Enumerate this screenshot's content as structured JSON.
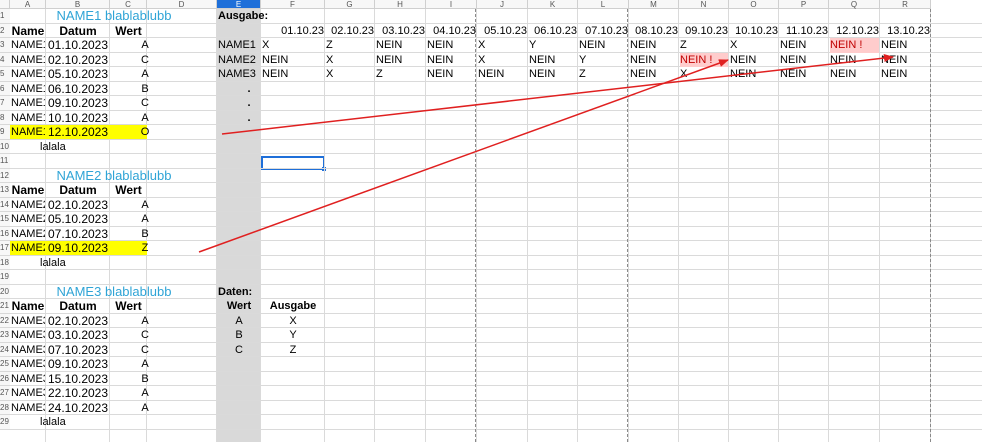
{
  "columns": [
    "A",
    "B",
    "C",
    "D",
    "E",
    "F",
    "G",
    "H",
    "I",
    "J",
    "K",
    "L",
    "M",
    "N",
    "O",
    "P",
    "Q",
    "R"
  ],
  "selected_column": "E",
  "rows": [
    "1",
    "2",
    "3",
    "4",
    "5",
    "6",
    "7",
    "8",
    "9",
    "10",
    "11",
    "12",
    "13",
    "14",
    "15",
    "16",
    "17",
    "18",
    "19",
    "20",
    "21",
    "22",
    "23",
    "24",
    "25",
    "26",
    "27",
    "28",
    "29"
  ],
  "sections": [
    {
      "title": "NAME1 blablablubb",
      "headers": [
        "Name",
        "Datum",
        "Wert"
      ],
      "rows": [
        [
          "NAME1",
          "01.10.2023",
          "A"
        ],
        [
          "NAME1",
          "02.10.2023",
          "C"
        ],
        [
          "NAME1",
          "05.10.2023",
          "A"
        ],
        [
          "NAME1",
          "06.10.2023",
          "B"
        ],
        [
          "NAME1",
          "09.10.2023",
          "C"
        ],
        [
          "NAME1",
          "10.10.2023",
          "A"
        ],
        [
          "NAME1",
          "12.10.2023",
          "O"
        ]
      ],
      "footer": "lalala"
    },
    {
      "title": "NAME2 blablablubb",
      "headers": [
        "Name",
        "Datum",
        "Wert"
      ],
      "rows": [
        [
          "NAME2",
          "02.10.2023",
          "A"
        ],
        [
          "NAME2",
          "05.10.2023",
          "A"
        ],
        [
          "NAME2",
          "07.10.2023",
          "B"
        ],
        [
          "NAME2",
          "09.10.2023",
          "Z"
        ]
      ],
      "footer": "lalala"
    },
    {
      "title": "NAME3 blablablubb",
      "headers": [
        "Name",
        "Datum",
        "Wert"
      ],
      "rows": [
        [
          "NAME3",
          "02.10.2023",
          "A"
        ],
        [
          "NAME3",
          "03.10.2023",
          "C"
        ],
        [
          "NAME3",
          "07.10.2023",
          "C"
        ],
        [
          "NAME3",
          "09.10.2023",
          "A"
        ],
        [
          "NAME3",
          "15.10.2023",
          "B"
        ],
        [
          "NAME3",
          "22.10.2023",
          "A"
        ],
        [
          "NAME3",
          "24.10.2023",
          "A"
        ]
      ],
      "footer": "lalala"
    }
  ],
  "output": {
    "label": "Ausgabe:",
    "dates": [
      "01.10.23",
      "02.10.23",
      "03.10.23",
      "04.10.23",
      "05.10.23",
      "06.10.23",
      "07.10.23",
      "08.10.23",
      "09.10.23",
      "10.10.23",
      "11.10.23",
      "12.10.23",
      "13.10.23"
    ],
    "rows": [
      {
        "name": "NAME1",
        "values": [
          "X",
          "Z",
          "NEIN",
          "NEIN",
          "X",
          "Y",
          "NEIN",
          "NEIN",
          "Z",
          "X",
          "NEIN",
          "NEIN !",
          "NEIN"
        ]
      },
      {
        "name": "NAME2",
        "values": [
          "NEIN",
          "X",
          "NEIN",
          "NEIN",
          "X",
          "NEIN",
          "Y",
          "NEIN",
          "NEIN !",
          "NEIN",
          "NEIN",
          "NEIN",
          "NEIN"
        ]
      },
      {
        "name": "NAME3",
        "values": [
          "NEIN",
          "X",
          "Z",
          "NEIN",
          "NEIN",
          "NEIN",
          "Z",
          "NEIN",
          "X",
          "NEIN",
          "NEIN",
          "NEIN",
          "NEIN"
        ]
      }
    ],
    "dots": [
      ".",
      ".",
      "."
    ]
  },
  "daten": {
    "label": "Daten:",
    "headers": [
      "Wert",
      "Ausgabe"
    ],
    "rows": [
      [
        "A",
        "X"
      ],
      [
        "B",
        "Y"
      ],
      [
        "C",
        "Z"
      ]
    ]
  },
  "colors": {
    "highlight_row": "#ffff00",
    "error_fill": "#ffcccc",
    "error_text": "#c00000",
    "title_blue": "#2fa4d6",
    "arrow": "#e02020",
    "selection": "#1e6fd9"
  }
}
